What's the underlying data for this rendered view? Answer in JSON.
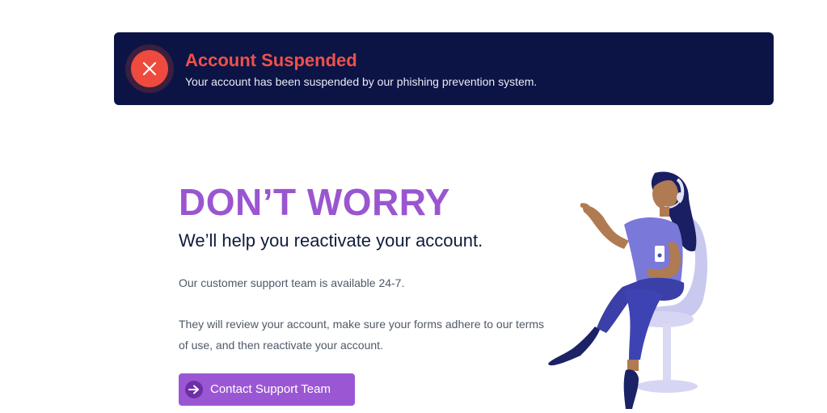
{
  "banner": {
    "title": "Account Suspended",
    "message": "Your account has been suspended by our phishing prevention system.",
    "icon": "close-icon",
    "background_color": "#0c1445",
    "accent_color": "#ef4a3e"
  },
  "main": {
    "headline": "DON’T WORRY",
    "subheadline": "We’ll help you reactivate your account.",
    "paragraph1": "Our customer support team is available 24-7.",
    "paragraph2": "They will review your account, make sure your forms adhere to our terms of use, and then reactivate your account.",
    "headline_color": "#9a55d0"
  },
  "cta": {
    "label": "Contact Support Team",
    "icon": "arrow-right-icon",
    "color": "#9b57d3"
  },
  "illustration": {
    "icon": "support-agent-illustration"
  }
}
